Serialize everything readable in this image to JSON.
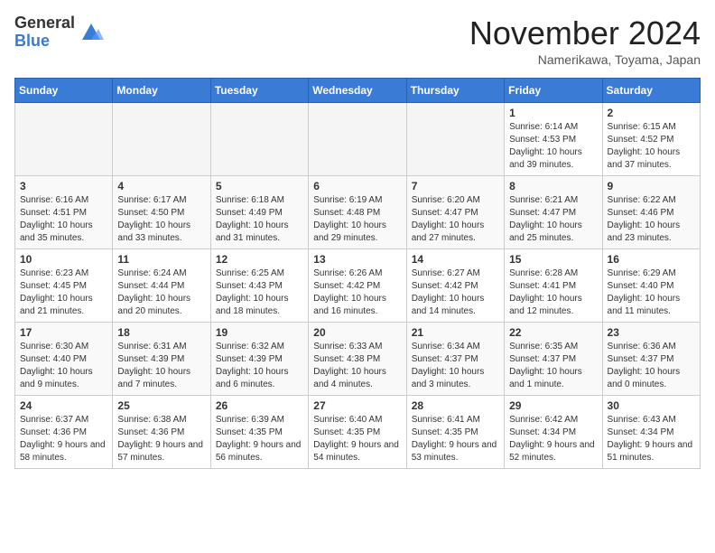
{
  "logo": {
    "general": "General",
    "blue": "Blue"
  },
  "title": "November 2024",
  "location": "Namerikawa, Toyama, Japan",
  "headers": [
    "Sunday",
    "Monday",
    "Tuesday",
    "Wednesday",
    "Thursday",
    "Friday",
    "Saturday"
  ],
  "weeks": [
    [
      {
        "day": "",
        "info": ""
      },
      {
        "day": "",
        "info": ""
      },
      {
        "day": "",
        "info": ""
      },
      {
        "day": "",
        "info": ""
      },
      {
        "day": "",
        "info": ""
      },
      {
        "day": "1",
        "info": "Sunrise: 6:14 AM\nSunset: 4:53 PM\nDaylight: 10 hours and 39 minutes."
      },
      {
        "day": "2",
        "info": "Sunrise: 6:15 AM\nSunset: 4:52 PM\nDaylight: 10 hours and 37 minutes."
      }
    ],
    [
      {
        "day": "3",
        "info": "Sunrise: 6:16 AM\nSunset: 4:51 PM\nDaylight: 10 hours and 35 minutes."
      },
      {
        "day": "4",
        "info": "Sunrise: 6:17 AM\nSunset: 4:50 PM\nDaylight: 10 hours and 33 minutes."
      },
      {
        "day": "5",
        "info": "Sunrise: 6:18 AM\nSunset: 4:49 PM\nDaylight: 10 hours and 31 minutes."
      },
      {
        "day": "6",
        "info": "Sunrise: 6:19 AM\nSunset: 4:48 PM\nDaylight: 10 hours and 29 minutes."
      },
      {
        "day": "7",
        "info": "Sunrise: 6:20 AM\nSunset: 4:47 PM\nDaylight: 10 hours and 27 minutes."
      },
      {
        "day": "8",
        "info": "Sunrise: 6:21 AM\nSunset: 4:47 PM\nDaylight: 10 hours and 25 minutes."
      },
      {
        "day": "9",
        "info": "Sunrise: 6:22 AM\nSunset: 4:46 PM\nDaylight: 10 hours and 23 minutes."
      }
    ],
    [
      {
        "day": "10",
        "info": "Sunrise: 6:23 AM\nSunset: 4:45 PM\nDaylight: 10 hours and 21 minutes."
      },
      {
        "day": "11",
        "info": "Sunrise: 6:24 AM\nSunset: 4:44 PM\nDaylight: 10 hours and 20 minutes."
      },
      {
        "day": "12",
        "info": "Sunrise: 6:25 AM\nSunset: 4:43 PM\nDaylight: 10 hours and 18 minutes."
      },
      {
        "day": "13",
        "info": "Sunrise: 6:26 AM\nSunset: 4:42 PM\nDaylight: 10 hours and 16 minutes."
      },
      {
        "day": "14",
        "info": "Sunrise: 6:27 AM\nSunset: 4:42 PM\nDaylight: 10 hours and 14 minutes."
      },
      {
        "day": "15",
        "info": "Sunrise: 6:28 AM\nSunset: 4:41 PM\nDaylight: 10 hours and 12 minutes."
      },
      {
        "day": "16",
        "info": "Sunrise: 6:29 AM\nSunset: 4:40 PM\nDaylight: 10 hours and 11 minutes."
      }
    ],
    [
      {
        "day": "17",
        "info": "Sunrise: 6:30 AM\nSunset: 4:40 PM\nDaylight: 10 hours and 9 minutes."
      },
      {
        "day": "18",
        "info": "Sunrise: 6:31 AM\nSunset: 4:39 PM\nDaylight: 10 hours and 7 minutes."
      },
      {
        "day": "19",
        "info": "Sunrise: 6:32 AM\nSunset: 4:39 PM\nDaylight: 10 hours and 6 minutes."
      },
      {
        "day": "20",
        "info": "Sunrise: 6:33 AM\nSunset: 4:38 PM\nDaylight: 10 hours and 4 minutes."
      },
      {
        "day": "21",
        "info": "Sunrise: 6:34 AM\nSunset: 4:37 PM\nDaylight: 10 hours and 3 minutes."
      },
      {
        "day": "22",
        "info": "Sunrise: 6:35 AM\nSunset: 4:37 PM\nDaylight: 10 hours and 1 minute."
      },
      {
        "day": "23",
        "info": "Sunrise: 6:36 AM\nSunset: 4:37 PM\nDaylight: 10 hours and 0 minutes."
      }
    ],
    [
      {
        "day": "24",
        "info": "Sunrise: 6:37 AM\nSunset: 4:36 PM\nDaylight: 9 hours and 58 minutes."
      },
      {
        "day": "25",
        "info": "Sunrise: 6:38 AM\nSunset: 4:36 PM\nDaylight: 9 hours and 57 minutes."
      },
      {
        "day": "26",
        "info": "Sunrise: 6:39 AM\nSunset: 4:35 PM\nDaylight: 9 hours and 56 minutes."
      },
      {
        "day": "27",
        "info": "Sunrise: 6:40 AM\nSunset: 4:35 PM\nDaylight: 9 hours and 54 minutes."
      },
      {
        "day": "28",
        "info": "Sunrise: 6:41 AM\nSunset: 4:35 PM\nDaylight: 9 hours and 53 minutes."
      },
      {
        "day": "29",
        "info": "Sunrise: 6:42 AM\nSunset: 4:34 PM\nDaylight: 9 hours and 52 minutes."
      },
      {
        "day": "30",
        "info": "Sunrise: 6:43 AM\nSunset: 4:34 PM\nDaylight: 9 hours and 51 minutes."
      }
    ]
  ]
}
